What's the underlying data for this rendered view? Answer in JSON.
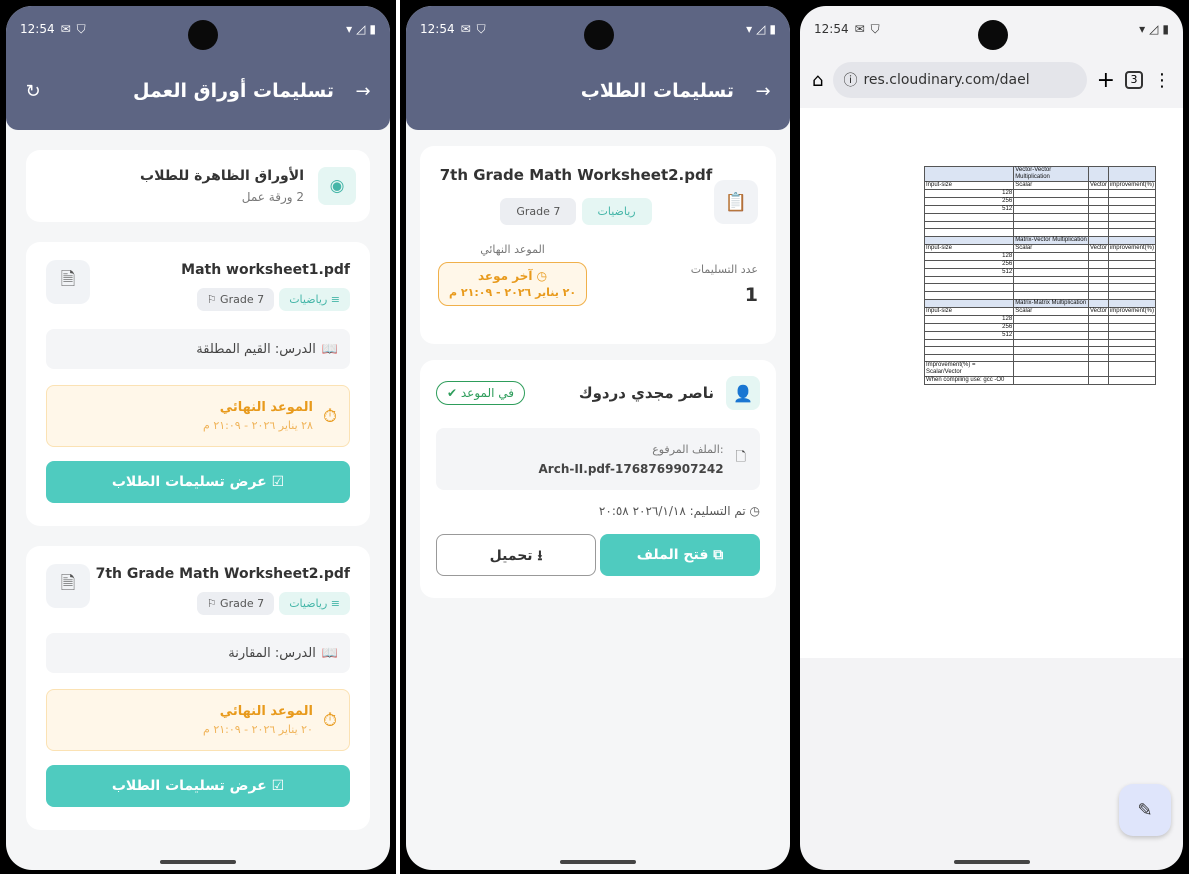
{
  "status": {
    "time": "12:54",
    "mail_icon": "M",
    "shield_icon": "shield"
  },
  "screen1": {
    "title": "تسليمات أوراق العمل",
    "visible": {
      "title": "الأوراق الظاهرة للطلاب",
      "count": "2 ورقة عمل"
    },
    "worksheets": [
      {
        "name": "Math worksheet1.pdf",
        "subject": "رياضيات",
        "grade": "Grade 7",
        "lesson": "الدرس: القيم المطلقة",
        "deadline_label": "الموعد النهائي",
        "deadline": "٢٨ يناير ٢٠٢٦ - ٢١:٠٩ م",
        "button": "عرض تسليمات الطلاب"
      },
      {
        "name": "7th Grade Math Worksheet2.pdf",
        "subject": "رياضيات",
        "grade": "Grade 7",
        "lesson": "الدرس: المقارنة",
        "deadline_label": "الموعد النهائي",
        "deadline": "٢٠ يناير ٢٠٢٦ - ٢١:٠٩ م",
        "button": "عرض تسليمات الطلاب"
      }
    ]
  },
  "screen2": {
    "title": "تسليمات الطلاب",
    "file": "7th Grade Math Worksheet2.pdf",
    "subject": "رياضيات",
    "grade": "Grade 7",
    "submissions_label": "عدد التسليمات",
    "submissions_count": "1",
    "deadline_label": "الموعد النهائي",
    "deadline_title": "آخر موعد",
    "deadline": "٢٠ يناير ٢٠٢٦ - ٢١:٠٩ م",
    "student": {
      "name": "ناصر مجدي دردوك",
      "status": "في الموعد",
      "uploaded_label": "الملف المرفوع:",
      "uploaded_file": "Arch-II.pdf-1768769907242",
      "submitted": "تم التسليم: ٢٠٢٦/١/١٨ ٢٠:٥٨",
      "open_button": "فتح الملف",
      "download_button": "تحميل"
    }
  },
  "screen3": {
    "url": "res.cloudinary.com/dael",
    "tabs_count": "3",
    "doc": {
      "sections": [
        {
          "heading": "Vector-Vector Multiplication",
          "rows": [
            "128",
            "256",
            "512"
          ]
        },
        {
          "heading": "Matrix-Vector Multiplication",
          "rows": [
            "128",
            "256",
            "512"
          ]
        },
        {
          "heading": "Matrix-Matrix Multiplication",
          "rows": [
            "128",
            "256",
            "512"
          ]
        }
      ],
      "columns": [
        "Input-size",
        "Scalar",
        "Vector",
        "improvement(%)"
      ],
      "footer1": "Improvement(%) = Scalar/Vector",
      "footer2": "When compiling use: gcc -O0"
    }
  },
  "colors": {
    "appbar": "#5d6583",
    "teal": "#4fcbbf",
    "orange": "#e89a1c",
    "green": "#2e9d5b"
  }
}
